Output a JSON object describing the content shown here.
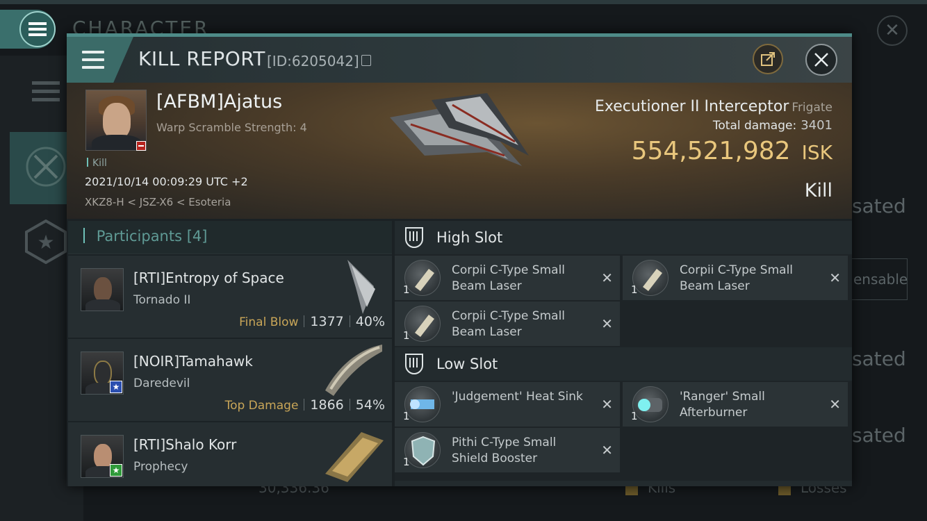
{
  "background": {
    "title": "CHARACTER",
    "right_labels": [
      "sated",
      "ensable",
      "sated",
      "sated"
    ],
    "bottom": {
      "value": "30,336.36",
      "kills_label": "Kills",
      "losses_label": "Losses"
    }
  },
  "header": {
    "title": "KILL REPORT",
    "id_text": "[ID:6205042]"
  },
  "victim": {
    "name": "[AFBM]Ajatus",
    "scramble": "Warp Scramble Strength: 4",
    "tag": "Kill",
    "datetime": "2021/10/14 00:09:29 UTC +2",
    "location": "XKZ8-H < JSZ-X6 < Esoteria",
    "ship_name": "Executioner II Interceptor",
    "ship_class": "Frigate",
    "total_damage_label": "Total damage:",
    "total_damage": "3401",
    "isk_value": "554,521,982",
    "isk_unit": "ISK",
    "result": "Kill"
  },
  "participants": {
    "label": "Participants",
    "count": "[4]",
    "items": [
      {
        "name": "[RTI]Entropy of Space",
        "ship": "Tornado II",
        "tag": "Final Blow",
        "damage": "1377",
        "percent": "40%",
        "badge": ""
      },
      {
        "name": "[NOIR]Tamahawk",
        "ship": "Daredevil",
        "tag": "Top Damage",
        "damage": "1866",
        "percent": "54%",
        "badge": "★"
      },
      {
        "name": "[RTI]Shalo Korr",
        "ship": "Prophecy",
        "tag": "",
        "damage": "",
        "percent": "",
        "badge": "★"
      }
    ]
  },
  "fittings": {
    "high_slot": {
      "title": "High Slot",
      "modules": [
        {
          "name": "Corpii C-Type Small Beam Laser",
          "qty": "1"
        },
        {
          "name": "Corpii C-Type Small Beam Laser",
          "qty": "1"
        },
        {
          "name": "Corpii C-Type Small Beam Laser",
          "qty": "1"
        }
      ]
    },
    "low_slot": {
      "title": "Low Slot",
      "modules": [
        {
          "name": "'Judgement' Heat Sink",
          "qty": "1"
        },
        {
          "name": "'Ranger' Small Afterburner",
          "qty": "1"
        },
        {
          "name": "Pithi C-Type Small Shield Booster",
          "qty": "1"
        }
      ]
    },
    "remove_glyph": "✕"
  },
  "colors": {
    "accent": "#4e8b88",
    "isk": "#e9c77d",
    "tag_gold": "#c9a658",
    "participants_label": "#5f9a95"
  }
}
